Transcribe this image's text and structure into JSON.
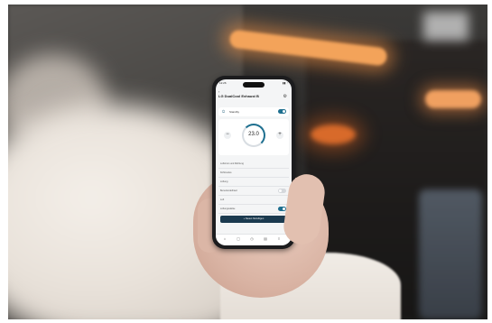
{
  "phone": {
    "status_time": "12:26",
    "app_title": "LG DualCool Exhaust B",
    "power_label": "Standby",
    "temperature": "23.0",
    "cta_label": "+ Neuen hinzufügen",
    "subtabs": [
      "Übersicht",
      "Verlauf",
      "Modus",
      "Automatisierung",
      "Einstellungen"
    ],
    "settings": [
      {
        "label": "Luftstrom und Richtung",
        "value": ""
      },
      {
        "label": "Kühlmodus",
        "value": ""
      },
      {
        "label": "Lüftung",
        "value": ""
      },
      {
        "label": "Benutzerdefiniert",
        "value": ""
      },
      {
        "label": "Luft",
        "value": ""
      },
      {
        "label": "Lüftungsstärke",
        "value": ""
      }
    ],
    "nav_icons": [
      "home-icon",
      "devices-icon",
      "routine-icon",
      "stats-icon",
      "menu-icon"
    ]
  },
  "colors": {
    "accent": "#1e6f8f",
    "cta": "#1b3a4f",
    "lamp": "#f3a35a"
  }
}
